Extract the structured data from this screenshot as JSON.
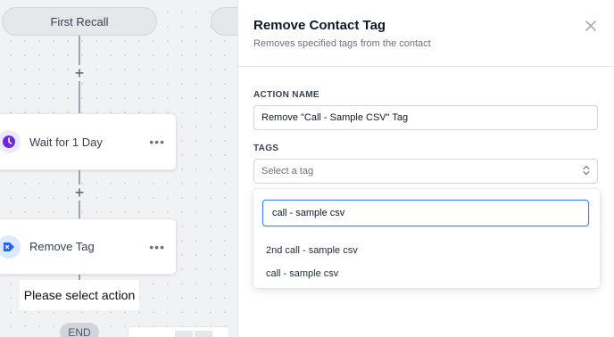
{
  "canvas": {
    "first_recall": "First Recall",
    "wait_node": {
      "label": "Wait for 1 Day",
      "more": "•••",
      "icon": "clock-icon",
      "icon_color": "#6d28d9"
    },
    "remove_tag_node": {
      "label": "Remove Tag",
      "more": "•••",
      "icon": "tag-remove-icon",
      "icon_color": "#2563eb"
    },
    "plus": "+",
    "tooltip": "Please select action",
    "end": "END"
  },
  "panel": {
    "title": "Remove Contact Tag",
    "subtitle": "Removes specified tags from the contact",
    "close_icon": "close-icon",
    "action_name_label": "ACTION NAME",
    "action_name_value": "Remove \"Call - Sample CSV\" Tag",
    "tags_label": "TAGS",
    "tags_placeholder": "Select a tag",
    "dropdown": {
      "search_value": "call - sample csv",
      "options": [
        "2nd call - sample csv",
        "call - sample csv"
      ]
    }
  },
  "colors": {
    "accent": "#3b82f6",
    "canvas_bg": "#f1f2f4"
  }
}
